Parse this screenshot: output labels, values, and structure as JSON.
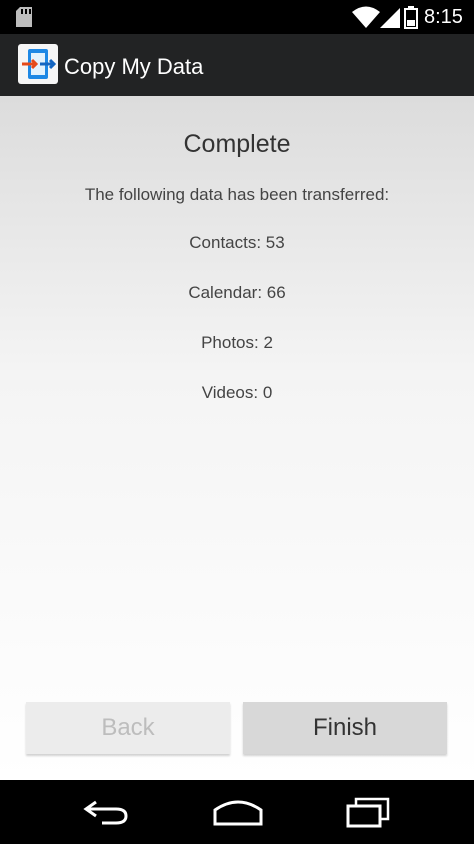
{
  "status_bar": {
    "time": "8:15",
    "icons": [
      "sd-card-icon",
      "wifi-icon",
      "signal-icon",
      "battery-icon"
    ]
  },
  "action_bar": {
    "app_icon": "copy-data-app-icon",
    "title": "Copy My Data"
  },
  "main": {
    "heading": "Complete",
    "subtitle": "The following data has been transferred:",
    "items": [
      "Contacts: 53",
      "Calendar: 66",
      "Photos: 2",
      "Videos: 0"
    ]
  },
  "buttons": {
    "back_label": "Back",
    "finish_label": "Finish"
  },
  "nav_bar": {
    "icons": [
      "back-nav-icon",
      "home-nav-icon",
      "recents-nav-icon"
    ]
  },
  "colors": {
    "status_bar": "#000000",
    "action_bar": "#222324",
    "back_button_disabled_text": "#bdbdbd",
    "finish_button_bg": "#d8d8d8"
  }
}
